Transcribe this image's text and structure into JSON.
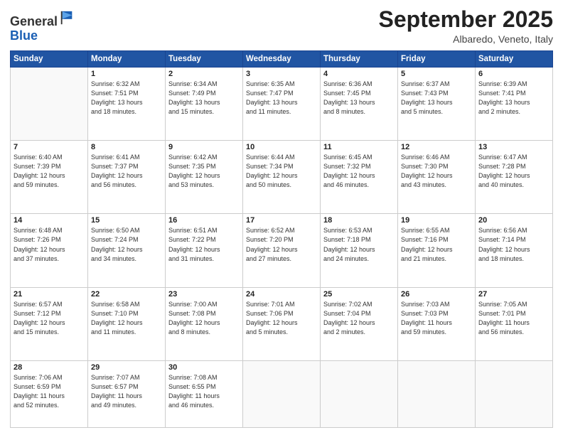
{
  "header": {
    "logo": {
      "line1": "General",
      "line2": "Blue"
    },
    "month": "September 2025",
    "location": "Albaredo, Veneto, Italy"
  },
  "weekdays": [
    "Sunday",
    "Monday",
    "Tuesday",
    "Wednesday",
    "Thursday",
    "Friday",
    "Saturday"
  ],
  "weeks": [
    [
      {
        "day": "",
        "info": ""
      },
      {
        "day": "1",
        "info": "Sunrise: 6:32 AM\nSunset: 7:51 PM\nDaylight: 13 hours\nand 18 minutes."
      },
      {
        "day": "2",
        "info": "Sunrise: 6:34 AM\nSunset: 7:49 PM\nDaylight: 13 hours\nand 15 minutes."
      },
      {
        "day": "3",
        "info": "Sunrise: 6:35 AM\nSunset: 7:47 PM\nDaylight: 13 hours\nand 11 minutes."
      },
      {
        "day": "4",
        "info": "Sunrise: 6:36 AM\nSunset: 7:45 PM\nDaylight: 13 hours\nand 8 minutes."
      },
      {
        "day": "5",
        "info": "Sunrise: 6:37 AM\nSunset: 7:43 PM\nDaylight: 13 hours\nand 5 minutes."
      },
      {
        "day": "6",
        "info": "Sunrise: 6:39 AM\nSunset: 7:41 PM\nDaylight: 13 hours\nand 2 minutes."
      }
    ],
    [
      {
        "day": "7",
        "info": "Sunrise: 6:40 AM\nSunset: 7:39 PM\nDaylight: 12 hours\nand 59 minutes."
      },
      {
        "day": "8",
        "info": "Sunrise: 6:41 AM\nSunset: 7:37 PM\nDaylight: 12 hours\nand 56 minutes."
      },
      {
        "day": "9",
        "info": "Sunrise: 6:42 AM\nSunset: 7:35 PM\nDaylight: 12 hours\nand 53 minutes."
      },
      {
        "day": "10",
        "info": "Sunrise: 6:44 AM\nSunset: 7:34 PM\nDaylight: 12 hours\nand 50 minutes."
      },
      {
        "day": "11",
        "info": "Sunrise: 6:45 AM\nSunset: 7:32 PM\nDaylight: 12 hours\nand 46 minutes."
      },
      {
        "day": "12",
        "info": "Sunrise: 6:46 AM\nSunset: 7:30 PM\nDaylight: 12 hours\nand 43 minutes."
      },
      {
        "day": "13",
        "info": "Sunrise: 6:47 AM\nSunset: 7:28 PM\nDaylight: 12 hours\nand 40 minutes."
      }
    ],
    [
      {
        "day": "14",
        "info": "Sunrise: 6:48 AM\nSunset: 7:26 PM\nDaylight: 12 hours\nand 37 minutes."
      },
      {
        "day": "15",
        "info": "Sunrise: 6:50 AM\nSunset: 7:24 PM\nDaylight: 12 hours\nand 34 minutes."
      },
      {
        "day": "16",
        "info": "Sunrise: 6:51 AM\nSunset: 7:22 PM\nDaylight: 12 hours\nand 31 minutes."
      },
      {
        "day": "17",
        "info": "Sunrise: 6:52 AM\nSunset: 7:20 PM\nDaylight: 12 hours\nand 27 minutes."
      },
      {
        "day": "18",
        "info": "Sunrise: 6:53 AM\nSunset: 7:18 PM\nDaylight: 12 hours\nand 24 minutes."
      },
      {
        "day": "19",
        "info": "Sunrise: 6:55 AM\nSunset: 7:16 PM\nDaylight: 12 hours\nand 21 minutes."
      },
      {
        "day": "20",
        "info": "Sunrise: 6:56 AM\nSunset: 7:14 PM\nDaylight: 12 hours\nand 18 minutes."
      }
    ],
    [
      {
        "day": "21",
        "info": "Sunrise: 6:57 AM\nSunset: 7:12 PM\nDaylight: 12 hours\nand 15 minutes."
      },
      {
        "day": "22",
        "info": "Sunrise: 6:58 AM\nSunset: 7:10 PM\nDaylight: 12 hours\nand 11 minutes."
      },
      {
        "day": "23",
        "info": "Sunrise: 7:00 AM\nSunset: 7:08 PM\nDaylight: 12 hours\nand 8 minutes."
      },
      {
        "day": "24",
        "info": "Sunrise: 7:01 AM\nSunset: 7:06 PM\nDaylight: 12 hours\nand 5 minutes."
      },
      {
        "day": "25",
        "info": "Sunrise: 7:02 AM\nSunset: 7:04 PM\nDaylight: 12 hours\nand 2 minutes."
      },
      {
        "day": "26",
        "info": "Sunrise: 7:03 AM\nSunset: 7:03 PM\nDaylight: 11 hours\nand 59 minutes."
      },
      {
        "day": "27",
        "info": "Sunrise: 7:05 AM\nSunset: 7:01 PM\nDaylight: 11 hours\nand 56 minutes."
      }
    ],
    [
      {
        "day": "28",
        "info": "Sunrise: 7:06 AM\nSunset: 6:59 PM\nDaylight: 11 hours\nand 52 minutes."
      },
      {
        "day": "29",
        "info": "Sunrise: 7:07 AM\nSunset: 6:57 PM\nDaylight: 11 hours\nand 49 minutes."
      },
      {
        "day": "30",
        "info": "Sunrise: 7:08 AM\nSunset: 6:55 PM\nDaylight: 11 hours\nand 46 minutes."
      },
      {
        "day": "",
        "info": ""
      },
      {
        "day": "",
        "info": ""
      },
      {
        "day": "",
        "info": ""
      },
      {
        "day": "",
        "info": ""
      }
    ]
  ]
}
